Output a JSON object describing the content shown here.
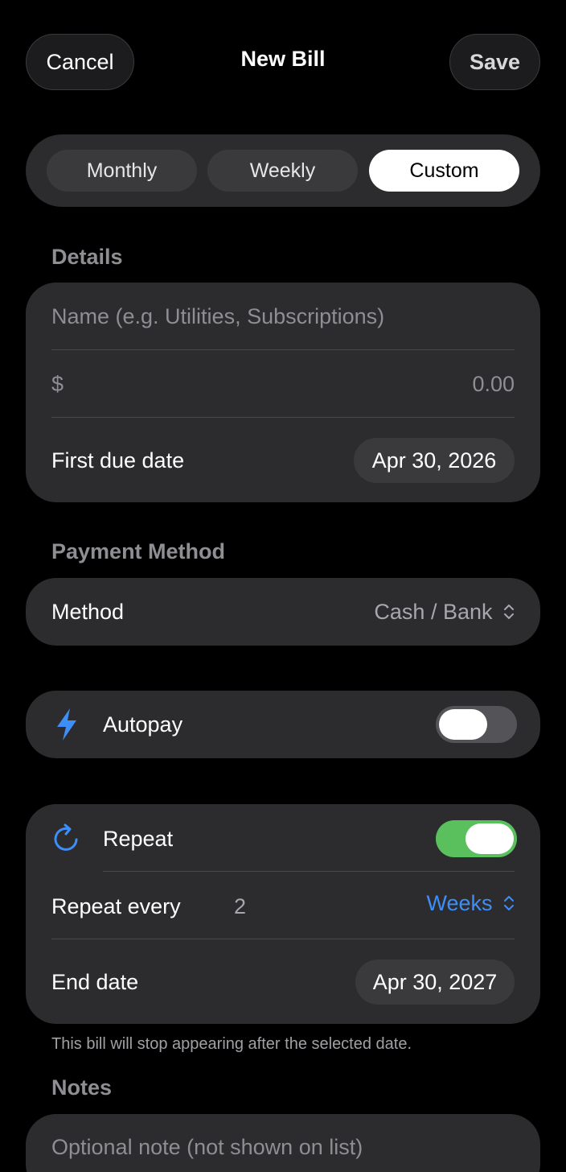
{
  "header": {
    "cancel_label": "Cancel",
    "title": "New Bill",
    "save_label": "Save"
  },
  "frequency": {
    "options": [
      "Monthly",
      "Weekly",
      "Custom"
    ],
    "selected": "Custom"
  },
  "details": {
    "section_label": "Details",
    "name_placeholder": "Name (e.g. Utilities, Subscriptions)",
    "currency_symbol": "$",
    "amount_placeholder": "0.00",
    "first_due_label": "First due date",
    "first_due_value": "Apr 30, 2026"
  },
  "payment": {
    "section_label": "Payment Method",
    "method_label": "Method",
    "method_value": "Cash / Bank",
    "method_chevron": "⌃⌄"
  },
  "autopay": {
    "icon": "bolt-icon",
    "label": "Autopay",
    "enabled": false
  },
  "repeat": {
    "icon": "repeat-icon",
    "label": "Repeat",
    "enabled": true,
    "every_label": "Repeat every",
    "every_value": "2",
    "unit_value": "Weeks",
    "end_label": "End date",
    "end_value": "Apr 30, 2027",
    "footnote": "This bill will stop appearing after the selected date."
  },
  "notes": {
    "section_label": "Notes",
    "placeholder": "Optional note (not shown on list)"
  },
  "colors": {
    "accent_blue": "#3e8ef7",
    "toggle_on": "#5ac05e",
    "card_bg": "#2c2c2e"
  }
}
